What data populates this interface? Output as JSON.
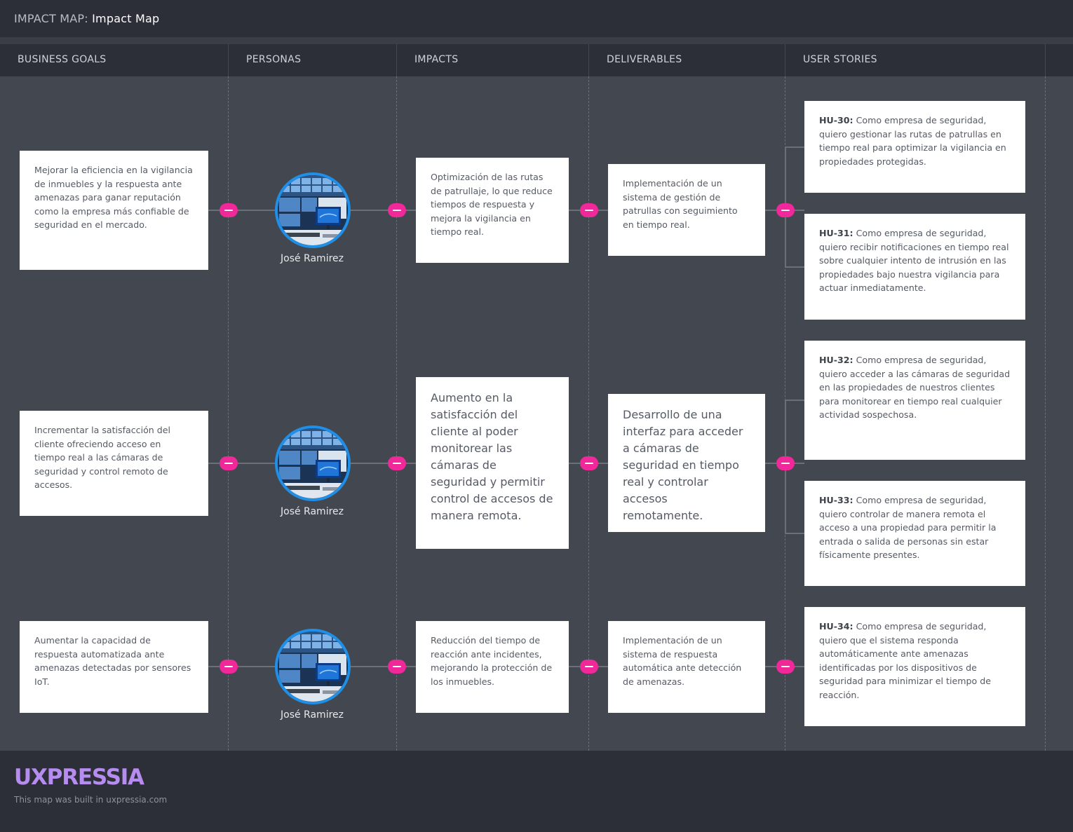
{
  "header": {
    "label": "IMPACT MAP:",
    "map_name": "Impact Map"
  },
  "columns": [
    "BUSINESS GOALS",
    "PERSONAS",
    "IMPACTS",
    "DELIVERABLES",
    "USER STORIES"
  ],
  "rows": [
    {
      "goal": "Mejorar la eficiencia en la vigilancia de inmuebles y la respuesta ante amenazas para ganar reputación como la empresa más confiable de seguridad en el mercado.",
      "persona": "José Ramirez",
      "impact": "Optimización de las rutas de patrullaje, lo que reduce tiempos de respuesta y mejora la vigilancia en tiempo real.",
      "deliverable": "Implementación de un sistema de gestión de patrullas con seguimiento en tiempo real.",
      "stories": [
        {
          "id": "HU-30:",
          "text": "Como empresa de seguridad, quiero gestionar las rutas de patrullas en tiempo real para optimizar la vigilancia en propiedades protegidas."
        },
        {
          "id": "HU-31:",
          "text": "Como empresa de seguridad, quiero recibir notificaciones en tiempo real sobre cualquier intento de intrusión en las propiedades bajo nuestra vigilancia para actuar inmediatamente."
        }
      ]
    },
    {
      "goal": "Incrementar la satisfacción del cliente ofreciendo acceso en tiempo real a las cámaras de seguridad y control remoto de accesos.",
      "persona": "José Ramirez",
      "impact": "Aumento en la satisfacción del cliente al poder monitorear las cámaras de seguridad y permitir control de accesos de manera remota.",
      "deliverable": "Desarrollo de una interfaz para acceder a cámaras de seguridad en tiempo real y controlar accesos remotamente.",
      "stories": [
        {
          "id": "HU-32:",
          "text": "Como empresa de seguridad, quiero acceder a las cámaras de seguridad en las propiedades de nuestros clientes para monitorear en tiempo real cualquier actividad sospechosa."
        },
        {
          "id": "HU-33:",
          "text": "Como empresa de seguridad, quiero controlar de manera remota el acceso a una propiedad para permitir la entrada o salida de personas sin estar físicamente presentes."
        }
      ]
    },
    {
      "goal": "Aumentar la capacidad de respuesta automatizada ante amenazas detectadas por sensores IoT.",
      "persona": "José Ramirez",
      "impact": "Reducción del tiempo de reacción ante incidentes, mejorando la protección de los inmuebles.",
      "deliverable": "Implementación de un sistema de respuesta automática ante detección de amenazas.",
      "stories": [
        {
          "id": "HU-34:",
          "text": "Como empresa de seguridad, quiero que el sistema responda automáticamente ante amenazas identificadas por los dispositivos de seguridad para minimizar el tiempo de reacción."
        }
      ]
    }
  ],
  "footer": {
    "logo": "UXPRESSIA",
    "built_text": "This map was built in uxpressia.com"
  },
  "colors": {
    "accent": "#f0289a",
    "avatar_ring": "#1f8fe8",
    "logo": "#b78cf0",
    "background": "#43474f",
    "bar": "#2d2f38"
  },
  "icons": {
    "toggle": "collapse-minus-icon",
    "persona": "security-monitors-avatar"
  }
}
